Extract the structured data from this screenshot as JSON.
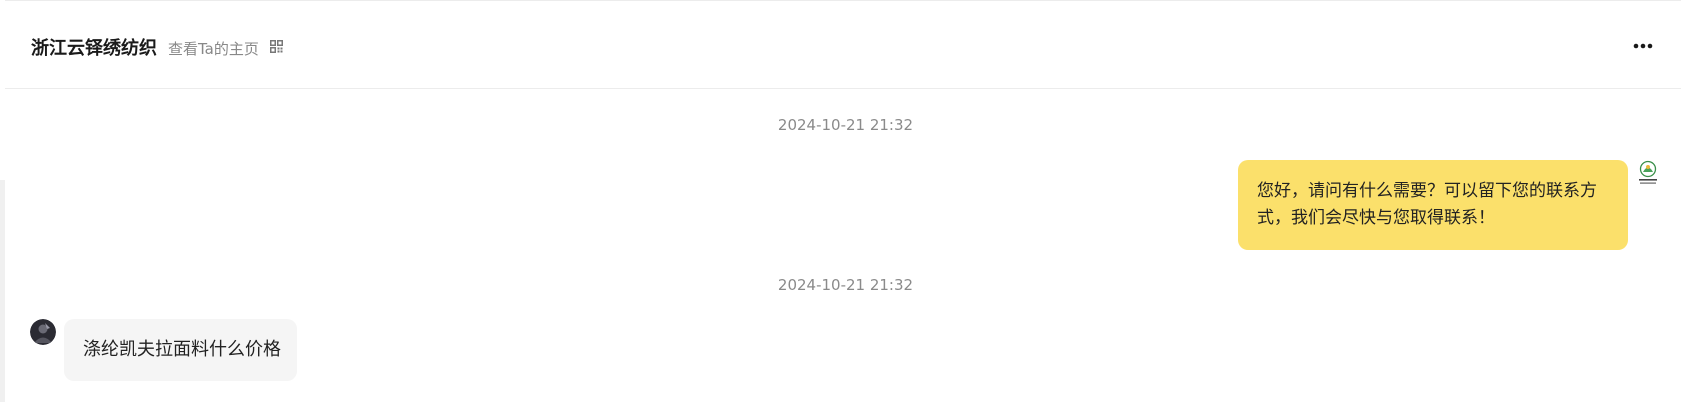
{
  "header": {
    "shop_name": "浙江云铎绣纺织",
    "view_home_label": "查看Ta的主页",
    "qr_icon": "qr-code-icon",
    "more_icon": "more-horizontal-icon"
  },
  "messages": [
    {
      "timestamp": "2024-10-21 21:32",
      "direction": "outgoing",
      "text": "您好，请问有什么需要？可以留下您的联系方式，我们会尽快与您取得联系！",
      "bubble_color": "#fbe06b"
    },
    {
      "timestamp": "2024-10-21 21:32",
      "direction": "incoming",
      "text": "涤纶凯夫拉面料什么价格",
      "bubble_color": "#f5f5f5"
    }
  ],
  "colors": {
    "accent_bubble": "#fbe06b",
    "incoming_bubble": "#f5f5f5",
    "muted_text": "#8a8a8a"
  }
}
